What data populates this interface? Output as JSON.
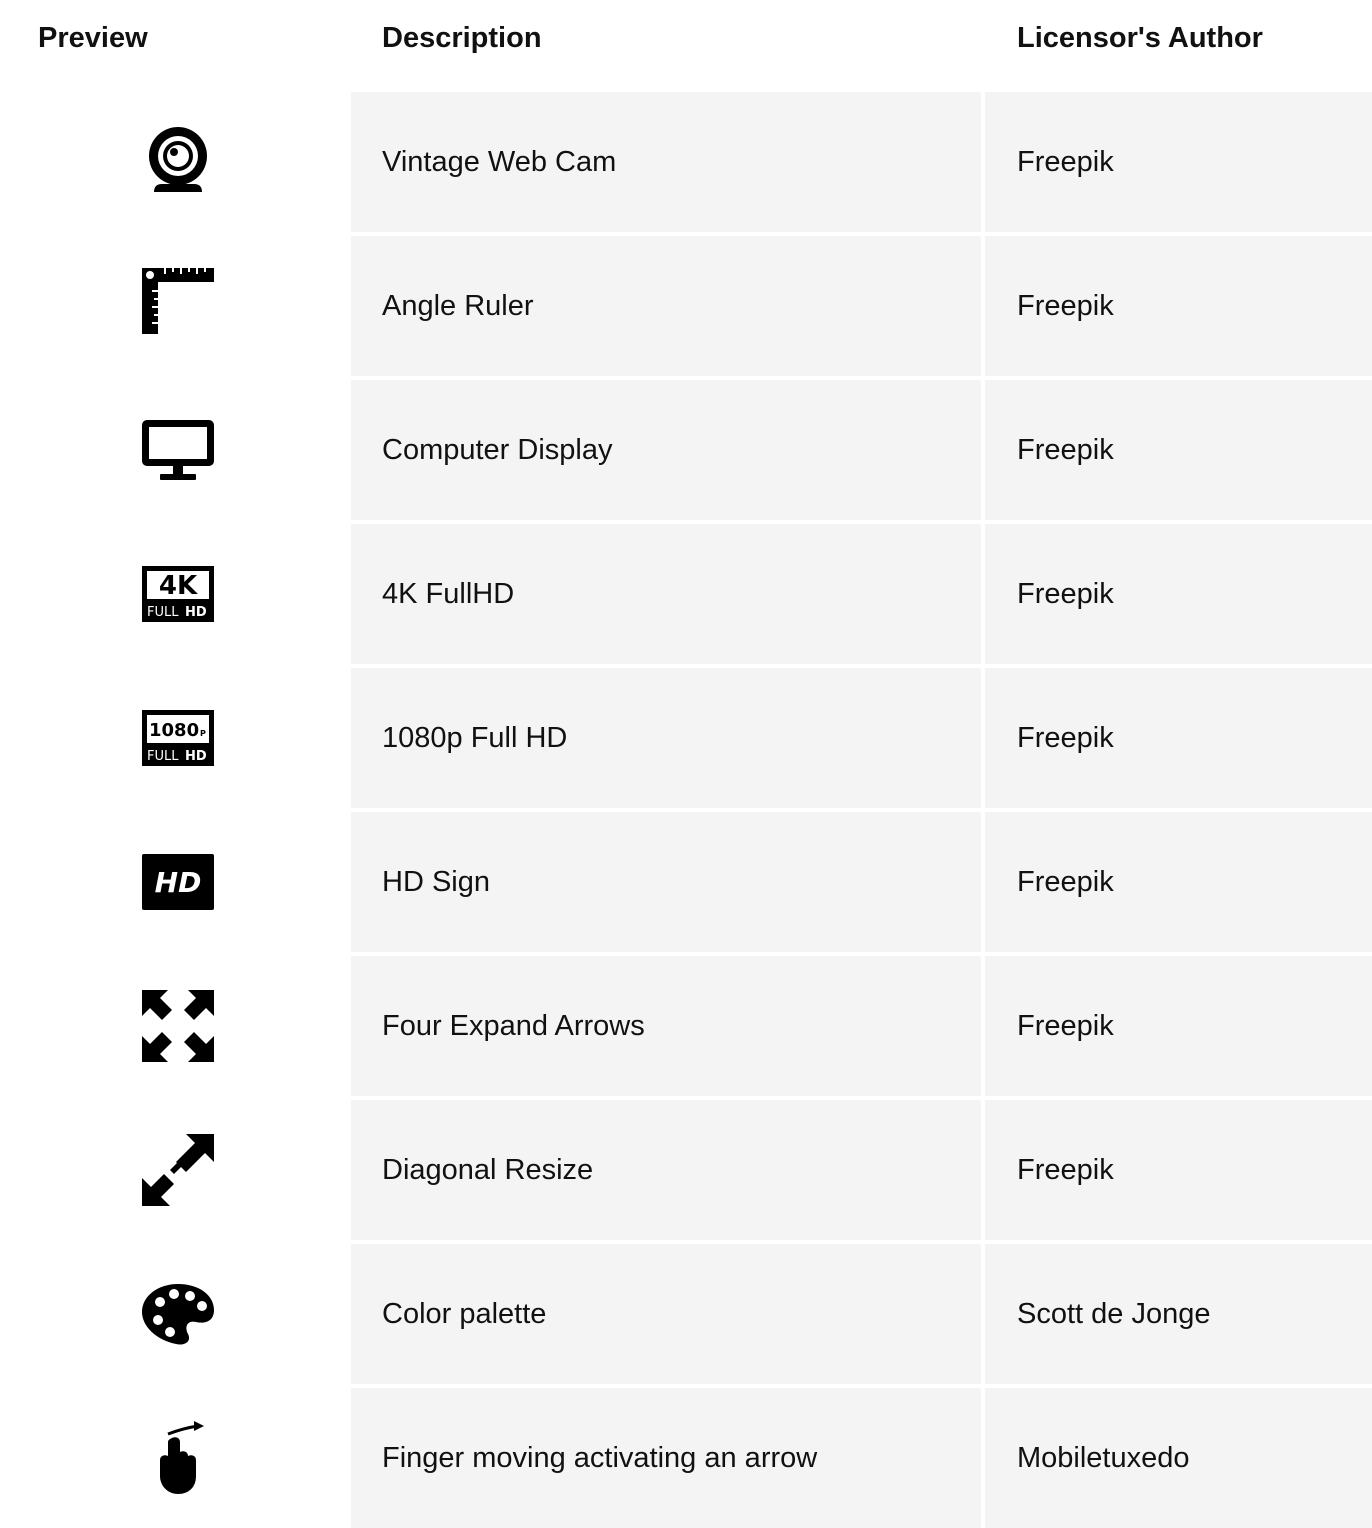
{
  "header": {
    "preview": "Preview",
    "description": "Description",
    "author": "Licensor's Author"
  },
  "rows": [
    {
      "icon": "webcam-icon",
      "description": "Vintage Web Cam",
      "author": "Freepik"
    },
    {
      "icon": "angle-ruler-icon",
      "description": "Angle Ruler",
      "author": "Freepik"
    },
    {
      "icon": "computer-display-icon",
      "description": "Computer Display",
      "author": "Freepik"
    },
    {
      "icon": "4k-fullhd-icon",
      "description": "4K FullHD",
      "author": "Freepik"
    },
    {
      "icon": "1080p-fullhd-icon",
      "description": "1080p Full HD",
      "author": "Freepik"
    },
    {
      "icon": "hd-sign-icon",
      "description": "HD Sign",
      "author": "Freepik"
    },
    {
      "icon": "four-expand-arrows-icon",
      "description": "Four Expand Arrows",
      "author": "Freepik"
    },
    {
      "icon": "diagonal-resize-icon",
      "description": "Diagonal Resize",
      "author": "Freepik"
    },
    {
      "icon": "color-palette-icon",
      "description": "Color palette",
      "author": "Scott de Jonge"
    },
    {
      "icon": "finger-arrow-icon",
      "description": "Finger moving activating an arrow",
      "author": "Mobiletuxedo"
    }
  ],
  "icon_text": {
    "fourk_main": "4K",
    "fourk_full": "FULL",
    "fourk_hd": "HD",
    "p1080_main": "1080",
    "p1080_p": "P",
    "p1080_full": "FULL",
    "p1080_hd": "HD",
    "hd_sign": "HD"
  }
}
